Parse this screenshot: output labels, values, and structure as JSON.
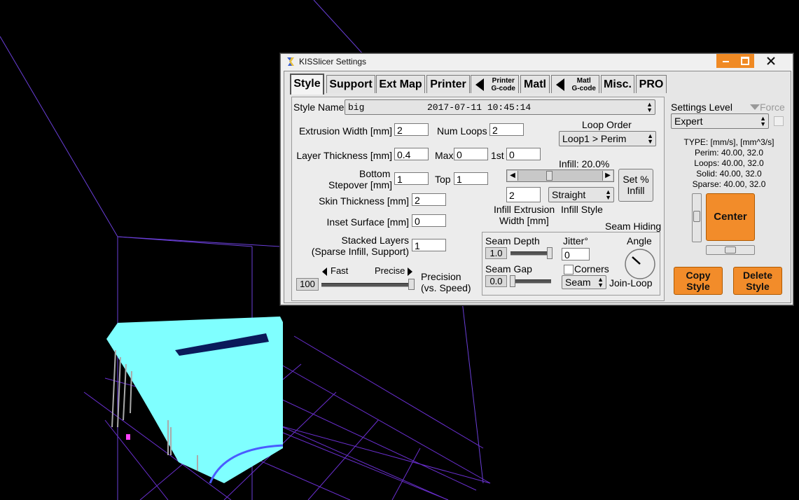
{
  "window": {
    "title": "KISSlicer Settings"
  },
  "tabs": [
    {
      "label": "Style"
    },
    {
      "label": "Support"
    },
    {
      "label": "Ext Map"
    },
    {
      "label": "Printer"
    },
    {
      "label": "Printer",
      "sub": "G-code"
    },
    {
      "label": "Matl"
    },
    {
      "label": "Matl",
      "sub": "G-code"
    },
    {
      "label": "Misc."
    },
    {
      "label": "PRO"
    }
  ],
  "style": {
    "style_name_label": "Style Name",
    "style_name": "big",
    "style_date": "2017-07-11 10:45:14",
    "extrusion_width_label": "Extrusion Width [mm]",
    "extrusion_width": "2",
    "num_loops_label": "Num Loops",
    "num_loops": "2",
    "loop_order_label": "Loop Order",
    "loop_order": "Loop1 > Perim",
    "layer_thickness_label": "Layer Thickness [mm]",
    "layer_thickness": "0.4",
    "max_label": "Max",
    "max": "0",
    "first_label": "1st",
    "first": "0",
    "infill_pct_label": "Infill: 20.0%",
    "bottom_label": "Bottom",
    "stepover_label": "Stepover [mm]",
    "bottom": "1",
    "top_label": "Top",
    "top": "1",
    "set_infill_line1": "Set %",
    "set_infill_line2": "Infill",
    "infill_ext_width": "2",
    "infill_style": "Straight",
    "infill_ext_label1": "Infill Extrusion",
    "infill_ext_label2": "Width [mm]",
    "infill_style_label": "Infill Style",
    "skin_thickness_label": "Skin Thickness [mm]",
    "skin_thickness": "2",
    "inset_surface_label": "Inset  Surface [mm]",
    "inset_surface": "0",
    "stacked_label1": "Stacked Layers",
    "stacked_label2": "(Sparse Infill, Support)",
    "stacked": "1",
    "fast_label": "Fast",
    "precise_label": "Precise",
    "precision_value": "100",
    "precision_label1": "Precision",
    "precision_label2": "(vs. Speed)",
    "infill_slider_fraction": 0.2,
    "precision_fraction": 1.0
  },
  "seam": {
    "title": "Seam Hiding",
    "depth_label": "Seam Depth",
    "depth": "1.0",
    "jitter_label": "Jitter°",
    "jitter": "0",
    "angle_label": "Angle",
    "gap_label": "Seam Gap",
    "gap": "0.0",
    "corners_label": "Corners",
    "corners_checked": false,
    "join_select": "Seam",
    "join_label": "Join-Loop"
  },
  "right": {
    "settings_level_label": "Settings Level",
    "force_label": "Force",
    "level": "Expert",
    "type_lines": [
      "TYPE: [mm/s], [mm^3/s]",
      "Perim:  40.00,  32.0",
      "Loops:  40.00,  32.0",
      "Solid:  40.00,  32.0",
      "Sparse:  40.00,  32.0"
    ],
    "center_label": "Center",
    "copy_line1": "Copy",
    "copy_line2": "Style",
    "delete_line1": "Delete",
    "delete_line2": "Style"
  },
  "colors": {
    "accent": "#f28c2a",
    "model": "#7fffff",
    "grid": "#7a3cff"
  }
}
